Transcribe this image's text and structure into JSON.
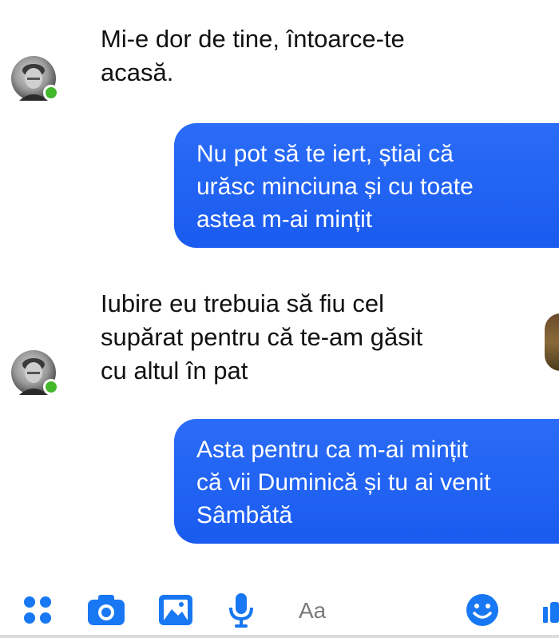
{
  "conversation": {
    "messages": [
      {
        "direction": "incoming",
        "text": "Mi-e dor de tine, întoarce-te\nacasă."
      },
      {
        "direction": "outgoing",
        "text": "Nu pot să te iert, știai că\nurăsc minciuna și cu toate\nastea m-ai mințit"
      },
      {
        "direction": "incoming",
        "text": "Iubire eu trebuia să fiu cel\nsupărat pentru că te-am găsit\ncu altul în pat"
      },
      {
        "direction": "outgoing",
        "text": "Asta pentru ca m-ai mințit\ncă vii Duminică și tu ai venit\nSâmbătă"
      }
    ]
  },
  "composer": {
    "placeholder": "Aa",
    "icons": [
      "apps-icon",
      "camera-icon",
      "gallery-icon",
      "microphone-icon",
      "emoji-icon",
      "like-icon"
    ]
  },
  "colors": {
    "outgoing_bubble": "#1a5bf0",
    "accent_icon": "#1877f2",
    "online_dot": "#42b72a"
  }
}
